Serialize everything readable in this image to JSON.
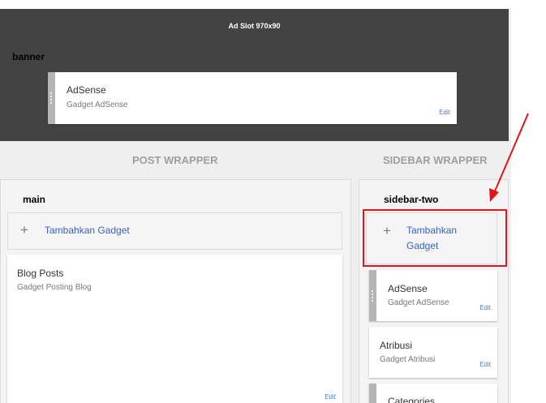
{
  "banner": {
    "ad_slot": "Ad Slot 970x90",
    "section_label": "banner",
    "gadget": {
      "title": "AdSense",
      "subtitle": "Gadget AdSense",
      "edit": "Edit"
    }
  },
  "wrappers": {
    "post": "POST WRAPPER",
    "sidebar": "SIDEBAR WRAPPER"
  },
  "main": {
    "title": "main",
    "add_gadget": "Tambahkan Gadget",
    "blog_posts": {
      "title": "Blog Posts",
      "subtitle": "Gadget Posting Blog",
      "edit": "Edit"
    }
  },
  "sidebar_two": {
    "title": "sidebar-two",
    "add_gadget_line1": "Tambahkan",
    "add_gadget_line2": "Gadget",
    "gadgets": [
      {
        "title": "AdSense",
        "subtitle": "Gadget AdSense",
        "edit": "Edit"
      },
      {
        "title": "Atribusi",
        "subtitle": "Gadget Atribusi",
        "edit": "Edit"
      },
      {
        "title": "Categories"
      }
    ]
  },
  "annotation": {
    "color": "#e0141b"
  }
}
